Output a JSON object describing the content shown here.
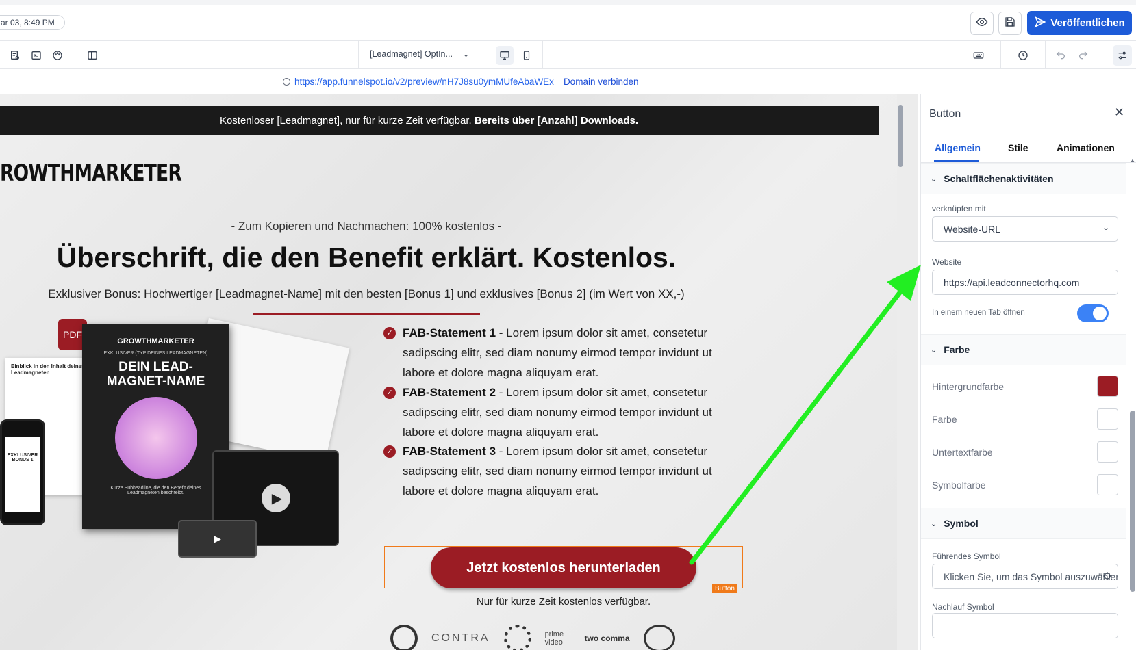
{
  "header": {
    "date": "ar 03, 8:49 PM",
    "publish_label": "Veröffentlichen"
  },
  "toolbar": {
    "page_name": "[Leadmagnet] OptIn..."
  },
  "urlbar": {
    "url": "https://app.funnelspot.io/v2/preview/nH7J8su0ymMUfeAbaWEx",
    "connect_label": "Domain verbinden"
  },
  "canvas": {
    "announcement_plain": "Kostenloser [Leadmagnet], nur für kurze Zeit verfügbar.",
    "announcement_bold": "Bereits über [Anzahl] Downloads.",
    "logo_text": "ROWTHMARKETER",
    "pre_headline": "- Zum Kopieren und Nachmachen: 100% kostenlos -",
    "headline": "Überschrift, die den Benefit erklärt. Kostenlos.",
    "subline": "Exklusiver Bonus: Hochwertiger [Leadmagnet-Name] mit den besten [Bonus 1] und exklusives [Bonus 2] (im Wert von XX,-)",
    "mockup": {
      "pdf_badge": "PDF",
      "book_brand": "GROWTHMARKETER",
      "book_kicker": "EXKLUSIVER (TYP DEINES LEADMAGNETEN)",
      "book_title": "DEIN LEAD-MAGNET-NAME",
      "book_footer": "Kurze Subheadline, die den Benefit deines Leadmagneten beschreibt.",
      "sheet_title": "Einblick in den Inhalt deines Leadmagneten",
      "phone_text": "EXKLUSIVER BONUS 1"
    },
    "fab": [
      {
        "title": "FAB-Statement 1",
        "text": " - Lorem ipsum dolor sit amet, consetetur sadipscing elitr, sed diam nonumy eirmod tempor invidunt ut labore et dolore magna aliquyam erat."
      },
      {
        "title": "FAB-Statement 2",
        "text": " - Lorem ipsum dolor sit amet, consetetur sadipscing elitr, sed diam nonumy eirmod tempor invidunt ut labore et dolore magna aliquyam erat."
      },
      {
        "title": "FAB-Statement 3",
        "text": " - Lorem ipsum dolor sit amet, consetetur sadipscing elitr, sed diam nonumy eirmod tempor invidunt ut labore et dolore magna aliquyam erat."
      }
    ],
    "cta_label": "Jetzt kostenlos herunterladen",
    "selection_tag": "Button",
    "cta_sub": "Nur für kurze Zeit kostenlos verfügbar.",
    "logos": [
      "CONTRA",
      "prime video",
      "two comma"
    ]
  },
  "panel": {
    "title": "Button",
    "tabs": [
      "Allgemein",
      "Stile",
      "Animationen"
    ],
    "active_tab": "Allgemein",
    "section_actions": "Schaltflächenaktivitäten",
    "link_label": "verknüpfen mit",
    "link_value": "Website-URL",
    "website_label": "Website",
    "website_value": "https://api.leadconnectorhq.com",
    "new_tab_label": "In einem neuen Tab öffnen",
    "new_tab_on": true,
    "section_color": "Farbe",
    "colors": [
      {
        "label": "Hintergrundfarbe",
        "value": "#9b1c24"
      },
      {
        "label": "Farbe",
        "value": "#ffffff"
      },
      {
        "label": "Untertextfarbe",
        "value": "#ffffff"
      },
      {
        "label": "Symbolfarbe",
        "value": "#ffffff"
      }
    ],
    "section_symbol": "Symbol",
    "leading_label": "Führendes Symbol",
    "leading_placeholder": "Klicken Sie, um das Symbol auszuwählen",
    "trailing_label": "Nachlauf Symbol"
  },
  "theme": {
    "accent": "#1d5bd8",
    "brand_red": "#9b1c24",
    "selection_orange": "#f07a1a",
    "annotation_arrow": "#22ee22"
  }
}
